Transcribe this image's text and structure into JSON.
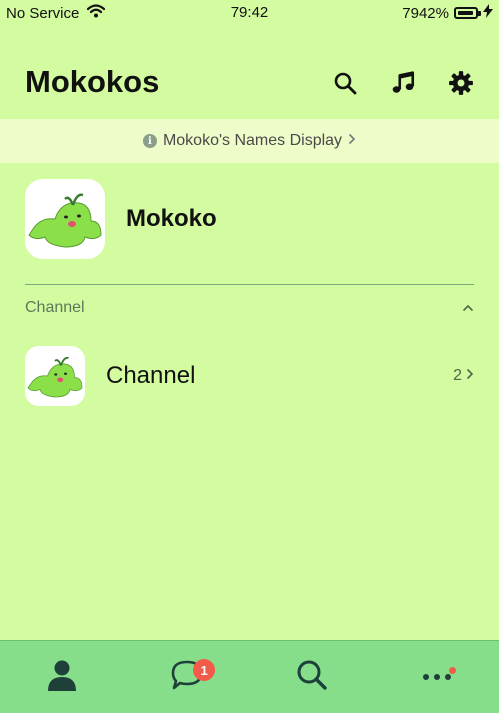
{
  "status": {
    "carrier": "No Service",
    "time": "79:42",
    "battery": "7942%"
  },
  "header": {
    "title": "Mokokos",
    "icons": [
      "search-icon",
      "music-icon",
      "gear-icon"
    ]
  },
  "notice": {
    "text": "Mokoko's Names Display"
  },
  "profile": {
    "name": "Mokoko"
  },
  "section": {
    "title": "Channel"
  },
  "channels": [
    {
      "name": "Channel",
      "count": "2"
    }
  ],
  "tabbar": {
    "tabs": [
      "person-icon",
      "chat-icon",
      "search-icon",
      "more-icon"
    ],
    "chat_badge": "1"
  },
  "colors": {
    "background": "#d3fb9f",
    "tab_bar": "#86de8a",
    "notice_bg": "#eefcc9",
    "badge": "#f25a4a"
  }
}
